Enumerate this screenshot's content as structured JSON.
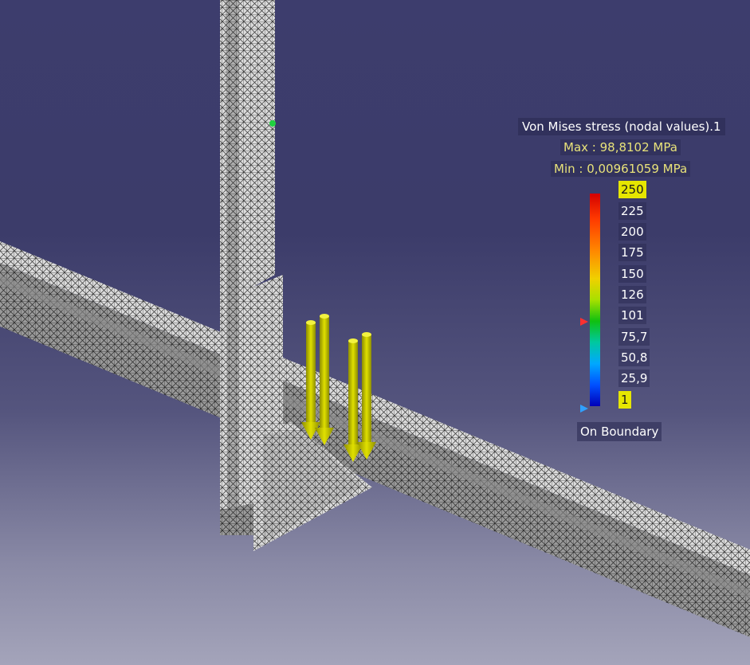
{
  "legend": {
    "title": "Von Mises stress (nodal values).1",
    "max": "Max : 98,8102 MPa",
    "min": "Min : 0,00961059 MPa",
    "ticks": [
      "250",
      "225",
      "200",
      "175",
      "150",
      "126",
      "101",
      "75,7",
      "50,8",
      "25,9",
      "1"
    ],
    "highlighted_ticks": [
      "250",
      "1"
    ],
    "boundary": "On Boundary",
    "colors": [
      "#d40000",
      "#ff8800",
      "#f0d000",
      "#10c010",
      "#00a8ff",
      "#0000b8"
    ]
  },
  "scene": {
    "background": "#3d3d6d",
    "mesh_color": "#d9d9d9",
    "load_arrow_color": "#c8c800",
    "max_marker": "red-triangle-marker",
    "min_marker": "blue-triangle-marker"
  }
}
